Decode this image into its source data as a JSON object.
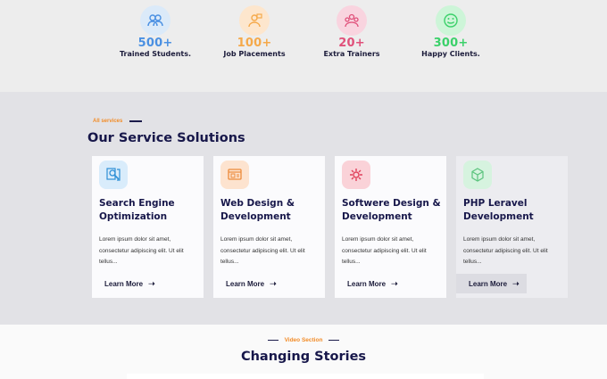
{
  "stats": [
    {
      "value": "500+",
      "label": "Trained Students.",
      "color": "#4a90e2",
      "bg": "#dbeaf9",
      "icon": "students-icon"
    },
    {
      "value": "100+",
      "label": "Job Placements",
      "color": "#f5a94a",
      "bg": "#fde6cd",
      "icon": "placement-icon"
    },
    {
      "value": "20+",
      "label": "Extra Trainers",
      "color": "#e0507a",
      "bg": "#f9d4df",
      "icon": "trainers-icon"
    },
    {
      "value": "300+",
      "label": "Happy Clients.",
      "color": "#3bd16a",
      "bg": "#cdf5d8",
      "icon": "happy-face-icon"
    }
  ],
  "services": {
    "eyebrow": "All services",
    "title": "Our Service Solutions",
    "cards": [
      {
        "title": "Search Engine Optimization",
        "text": "Lorem ipsum dolor sit amet, consectetur adipiscing elit. Ut elit tellus...",
        "more": "Learn More",
        "icon": "seo-search-icon",
        "icon_bg": "#d9ecfb",
        "icon_color": "#2e8fd6"
      },
      {
        "title": "Web Design & Development",
        "text": "Lorem ipsum dolor sit amet, consectetur adipiscing elit. Ut elit tellus...",
        "more": "Learn More",
        "icon": "web-design-icon",
        "icon_bg": "#fde3cf",
        "icon_color": "#ec8a3a"
      },
      {
        "title": "Softwere Design & Development",
        "text": "Lorem ipsum dolor sit amet, consectetur adipiscing elit. Ut elit tellus...",
        "more": "Learn More",
        "icon": "software-gear-icon",
        "icon_bg": "#fad2d8",
        "icon_color": "#e0405a"
      },
      {
        "title": "PHP Leravel Development",
        "text": "Lorem ipsum dolor sit amet, consectetur adipiscing elit. Ut elit tellus...",
        "more": "Learn More",
        "icon": "cube-icon",
        "icon_bg": "#d6f3df",
        "icon_color": "#5cc47e"
      }
    ]
  },
  "video": {
    "eyebrow": "Video Section",
    "title": "Changing Stories"
  }
}
